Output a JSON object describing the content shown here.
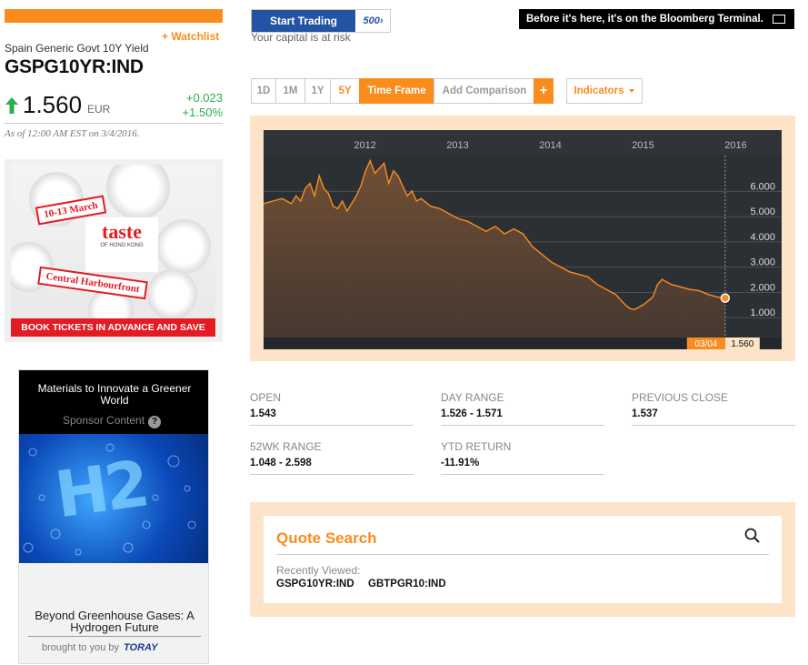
{
  "header": {
    "watchlist_label": "+ Watchlist",
    "security_name": "Spain Generic Govt 10Y Yield",
    "ticker": "GSPG10YR:IND",
    "price": "1.560",
    "currency": "EUR",
    "change_abs": "+0.023",
    "change_pct": "+1.50%",
    "as_of": "As of 12:00 AM EST on 3/4/2016.",
    "up_color": "#2ab04a"
  },
  "ad_taste": {
    "date_ribbon": "10-13 March",
    "logo_main": "taste",
    "logo_sub": "OF HONG KONG",
    "venue_ribbon": "Central Harbourfront",
    "banner": "BOOK TICKETS IN ADVANCE AND SAVE"
  },
  "ad_toray": {
    "title": "Materials to Innovate a Greener World",
    "sponsor": "Sponsor Content",
    "help": "?",
    "image_text": "H2",
    "caption": "Beyond Greenhouse Gases: A Hydrogen Future",
    "brought_by": "brought to you by",
    "brand": "TORAY"
  },
  "trading": {
    "button_label": "Start Trading",
    "logo": "500›",
    "risk": "Your capital is at risk"
  },
  "bloomberg_banner": "Before it's here, it's on the Bloomberg Terminal.",
  "timeframes": {
    "d1": "1D",
    "m1": "1M",
    "y1": "1Y",
    "y5": "5Y",
    "frame": "Time Frame",
    "compare": "Add Comparison",
    "plus": "+",
    "indicators": "Indicators"
  },
  "colors": {
    "accent": "#fa8c1e",
    "chart_bg": "#2b3035",
    "trade_blue": "#2453a3"
  },
  "chart_data": {
    "type": "area",
    "x_ticks": [
      "2012",
      "2013",
      "2014",
      "2015",
      "2016"
    ],
    "y_ticks": [
      "6.000",
      "5.000",
      "4.000",
      "3.000",
      "2.000",
      "1.000"
    ],
    "ylim": [
      0,
      7.2
    ],
    "xlim": [
      2011.2,
      2016.25
    ],
    "grid": true,
    "last_date_label": "03/04",
    "last_value_label": "1.560",
    "series": [
      {
        "x": [
          2011.2,
          2011.3,
          2011.4,
          2011.5,
          2011.55,
          2011.6,
          2011.65,
          2011.7,
          2011.75,
          2011.8,
          2011.85,
          2011.9,
          2011.95,
          2012.0,
          2012.05,
          2012.1,
          2012.15,
          2012.2,
          2012.25,
          2012.3,
          2012.35,
          2012.4,
          2012.45,
          2012.5,
          2012.55,
          2012.6,
          2012.65,
          2012.7,
          2012.75,
          2012.8,
          2012.85,
          2012.9,
          2013.0,
          2013.1,
          2013.2,
          2013.3,
          2013.4,
          2013.5,
          2013.6,
          2013.7,
          2013.8,
          2013.9,
          2014.0,
          2014.1,
          2014.2,
          2014.3,
          2014.4,
          2014.5,
          2014.6,
          2014.7,
          2014.8,
          2014.9,
          2015.0,
          2015.05,
          2015.1,
          2015.15,
          2015.2,
          2015.3,
          2015.4,
          2015.45,
          2015.5,
          2015.6,
          2015.7,
          2015.8,
          2015.9,
          2016.0,
          2016.1,
          2016.18
        ],
        "y": [
          5.3,
          5.4,
          5.5,
          5.3,
          5.6,
          5.4,
          5.9,
          6.1,
          5.6,
          6.4,
          5.9,
          5.7,
          5.2,
          5.1,
          5.4,
          5.0,
          5.3,
          5.6,
          6.0,
          6.6,
          7.0,
          6.5,
          6.7,
          6.9,
          6.1,
          6.6,
          6.4,
          6.0,
          5.6,
          5.8,
          5.4,
          5.5,
          5.2,
          5.1,
          4.9,
          4.7,
          4.6,
          4.4,
          4.2,
          4.4,
          4.1,
          4.3,
          4.1,
          3.6,
          3.3,
          3.0,
          2.8,
          2.6,
          2.5,
          2.4,
          2.1,
          1.9,
          1.7,
          1.5,
          1.3,
          1.15,
          1.1,
          1.3,
          1.6,
          2.1,
          2.3,
          2.1,
          2.0,
          1.9,
          1.85,
          1.7,
          1.6,
          1.56
        ]
      }
    ]
  },
  "stats": {
    "open_label": "OPEN",
    "open_value": "1.543",
    "day_range_label": "DAY RANGE",
    "day_range_value": "1.526 - 1.571",
    "prev_close_label": "PREVIOUS CLOSE",
    "prev_close_value": "1.537",
    "wk52_label": "52WK RANGE",
    "wk52_value": "1.048 - 2.598",
    "ytd_label": "YTD RETURN",
    "ytd_value": "-11.91%"
  },
  "quote_search": {
    "title": "Quote Search",
    "recent_label": "Recently Viewed:",
    "recent": [
      "GSPG10YR:IND",
      "GBTPGR10:IND"
    ]
  }
}
